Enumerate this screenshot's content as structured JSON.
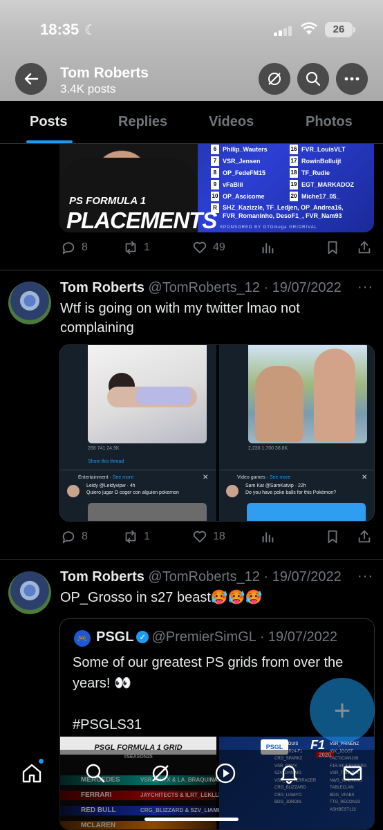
{
  "status_bar": {
    "time": "18:35",
    "battery": "26"
  },
  "header": {
    "name": "Tom Roberts",
    "post_count": "3.4K posts"
  },
  "tabs": [
    {
      "label": "Posts",
      "active": true
    },
    {
      "label": "Replies",
      "active": false
    },
    {
      "label": "Videos",
      "active": false
    },
    {
      "label": "Photos",
      "active": false
    }
  ],
  "placements_image": {
    "title_line1": "PS FORMULA 1",
    "title_line2": "PLACEMENTS",
    "rows": [
      {
        "n1": "6",
        "d1": "Philip_Wauters",
        "n2": "16",
        "d2": "FVR_LouisVLT"
      },
      {
        "n1": "7",
        "d1": "VSR_Jensen",
        "n2": "17",
        "d2": "RowinBolluijt"
      },
      {
        "n1": "8",
        "d1": "OP_FedeFM15",
        "n2": "18",
        "d2": "TF_Rudie"
      },
      {
        "n1": "9",
        "d1": "vFaBiii",
        "n2": "19",
        "d2": "EGT_MARKADOZ"
      },
      {
        "n1": "10",
        "d1": "OP_Ascicome",
        "n2": "20",
        "d2": "Miche17_05_"
      }
    ],
    "reserve_label": "R",
    "reserve_text": "SHZ_Kazizzle, TF_Ledjen, OP_Andrea16, FVR_Romaninho, DesoF1_, FVR_Nam93",
    "sponsors": "SPONSORED BY    GTOmega    GRIDRIVAL"
  },
  "post1_actions": {
    "replies": "8",
    "reposts": "1",
    "likes": "49"
  },
  "tweet2": {
    "name": "Tom Roberts",
    "meta": "@TomRoberts_12 · 19/07/2022",
    "text": "Wtf is going on with my twitter lmao not complaining",
    "media_left": {
      "stats": "268      741      24.9K",
      "show_thread": "Show this thread",
      "category": "Entertainment · ",
      "see_more": "See more",
      "user": "Leidy @Leidyvipw · 4h",
      "text": "Quiero jugar O coger con alguien pokemon"
    },
    "media_right": {
      "stats": "2,236      1,700      38.8K",
      "category": "Video games · ",
      "see_more": "See more",
      "user": "Sam Kat @SamKatvip · 22h",
      "text": "Do you have poke balls for this Pokémon?"
    },
    "actions": {
      "replies": "8",
      "reposts": "1",
      "likes": "18"
    }
  },
  "tweet3": {
    "name": "Tom Roberts",
    "meta": "@TomRoberts_12 · 19/07/2022",
    "text": "OP_Grosso in s27 beast🥵🥵🥵",
    "quote": {
      "logo": "🎮",
      "name": "PSGL",
      "meta": "@PremierSimGL · 19/07/2022",
      "text_line1": "Some of our greatest PS grids from over the years! 👀",
      "text_line2": "#PSGLS31",
      "grid_title": "PSGL FORMULA 1 GRID",
      "grid_season": "#SEASON25",
      "teams": [
        {
          "team": "MERCEDES",
          "drivers": "VSR_ONYX & LA_BRAQUINA91"
        },
        {
          "team": "FERRARI",
          "drivers": "JAYCHITECTS & ILRT_LEKLLE16"
        },
        {
          "team": "RED BULL",
          "drivers": "CRG_BLIZZARD & SZV_LIAMPARNELL"
        },
        {
          "team": "MCLAREN",
          "drivers": ""
        }
      ],
      "img2_badge": "PSGL",
      "img2_f1": "F1",
      "img2_year": "2020",
      "img2_drivers_left": [
        "BDG_LOUIS",
        "CASPER24-F1",
        "CRG_SPARKZ",
        "VSR_ONYX",
        "SZV_DANIMG",
        "VSR_VASTERRACER",
        "CRG_BLIZZARD",
        "CRG_LIAMYO",
        "BDG_JORDIN"
      ],
      "img2_drivers_right": [
        "VSR_PRINENZ",
        "IGK_JOOST",
        "TACTICIAN109",
        "F1R-INUERNBERG",
        "VSR_THIJMEN",
        "NWS_WAUTERS",
        "TABLECLAN",
        "BDG_VFABII",
        "TTG_RECON33",
        "ASHBEST122"
      ]
    }
  },
  "colors": {
    "accent": "#1d9bf0",
    "background": "#000000",
    "muted": "#71767b",
    "text": "#e7e9ea"
  }
}
